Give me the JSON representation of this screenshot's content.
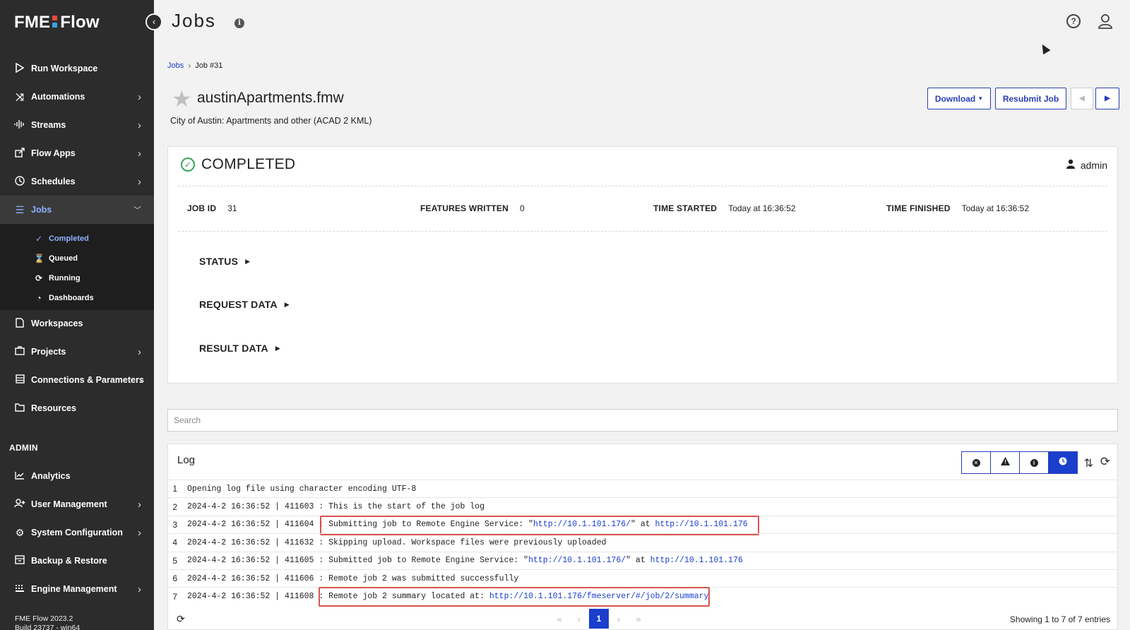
{
  "app": {
    "logo_left": "FME",
    "logo_right": "Flow",
    "logo_colors": [
      "#e84b3a",
      "#f5a623",
      "#3aa0e8",
      "#8bc34a"
    ],
    "version_line1": "FME Flow 2023.2",
    "version_line2": "Build 23737 - win64"
  },
  "sidebar": {
    "items": [
      {
        "label": "Run Workspace",
        "icon": "play-icon"
      },
      {
        "label": "Automations",
        "icon": "shuffle-icon"
      },
      {
        "label": "Streams",
        "icon": "waveform-icon"
      },
      {
        "label": "Flow Apps",
        "icon": "share-icon"
      },
      {
        "label": "Schedules",
        "icon": "clock-icon"
      },
      {
        "label": "Jobs",
        "icon": "list-icon"
      },
      {
        "label": "Workspaces",
        "icon": "file-icon"
      },
      {
        "label": "Projects",
        "icon": "briefcase-icon"
      },
      {
        "label": "Connections & Parameters",
        "icon": "database-icon"
      },
      {
        "label": "Resources",
        "icon": "folder-icon"
      }
    ],
    "jobs_sub": [
      {
        "label": "Completed",
        "icon": "check-circle-icon"
      },
      {
        "label": "Queued",
        "icon": "hourglass-icon"
      },
      {
        "label": "Running",
        "icon": "sync-icon"
      },
      {
        "label": "Dashboards",
        "icon": "pie-chart-icon"
      }
    ],
    "admin_label": "ADMIN",
    "admin_items": [
      {
        "label": "Analytics",
        "icon": "chart-line-icon"
      },
      {
        "label": "User Management",
        "icon": "user-plus-icon"
      },
      {
        "label": "System Configuration",
        "icon": "gear-icon"
      },
      {
        "label": "Backup & Restore",
        "icon": "archive-icon"
      },
      {
        "label": "Engine Management",
        "icon": "server-icon"
      }
    ]
  },
  "header": {
    "title": "Jobs",
    "info_glyph": "i",
    "help_glyph": "?"
  },
  "breadcrumb": {
    "root": "Jobs",
    "current": "Job #31"
  },
  "job": {
    "name": "austinApartments.fmw",
    "description": "City of Austin: Apartments and other (ACAD 2 KML)",
    "download_label": "Download",
    "resubmit_label": "Resubmit Job"
  },
  "status_card": {
    "status": "COMPLETED",
    "owner": "admin",
    "meta": [
      {
        "key": "JOB ID",
        "value": "31"
      },
      {
        "key": "FEATURES WRITTEN",
        "value": "0"
      },
      {
        "key": "TIME STARTED",
        "value": "Today at 16:36:52"
      },
      {
        "key": "TIME FINISHED",
        "value": "Today at 16:36:52"
      }
    ],
    "sections": [
      "STATUS",
      "REQUEST DATA",
      "RESULT DATA"
    ]
  },
  "search": {
    "placeholder": "Search"
  },
  "log": {
    "title": "Log",
    "filter_colors": {
      "accent": "#1a3fcc",
      "highlight": "#d9534f"
    },
    "rows": [
      {
        "n": "1",
        "text": "Opening log file using character encoding UTF-8"
      },
      {
        "n": "2",
        "text": "2024-4-2 16:36:52 | 411603 : This is the start of the job log"
      },
      {
        "n": "3",
        "pre": "2024-4-2 16:36:52 | 411604 : Submitting job to Remote Engine Service: \"",
        "link1": "http://10.1.101.176/",
        "mid": "\" at ",
        "link2": "http://10.1.101.176"
      },
      {
        "n": "4",
        "text": "2024-4-2 16:36:52 | 411632 : Skipping upload. Workspace files were previously uploaded"
      },
      {
        "n": "5",
        "pre": "2024-4-2 16:36:52 | 411605 : Submitted job to Remote Engine Service: \"",
        "link1": "http://10.1.101.176/",
        "mid": "\" at ",
        "link2": "http://10.1.101.176"
      },
      {
        "n": "6",
        "text": "2024-4-2 16:36:52 | 411606 : Remote job 2 was submitted successfully"
      },
      {
        "n": "7",
        "pre": "2024-4-2 16:36:52 | 411608 : Remote job 2 summary located at: ",
        "link1": "http://10.1.101.176/fmeserver/#/job/2/summary"
      }
    ],
    "pager": {
      "current": "1",
      "entries": "Showing 1 to 7 of 7 entries"
    }
  }
}
